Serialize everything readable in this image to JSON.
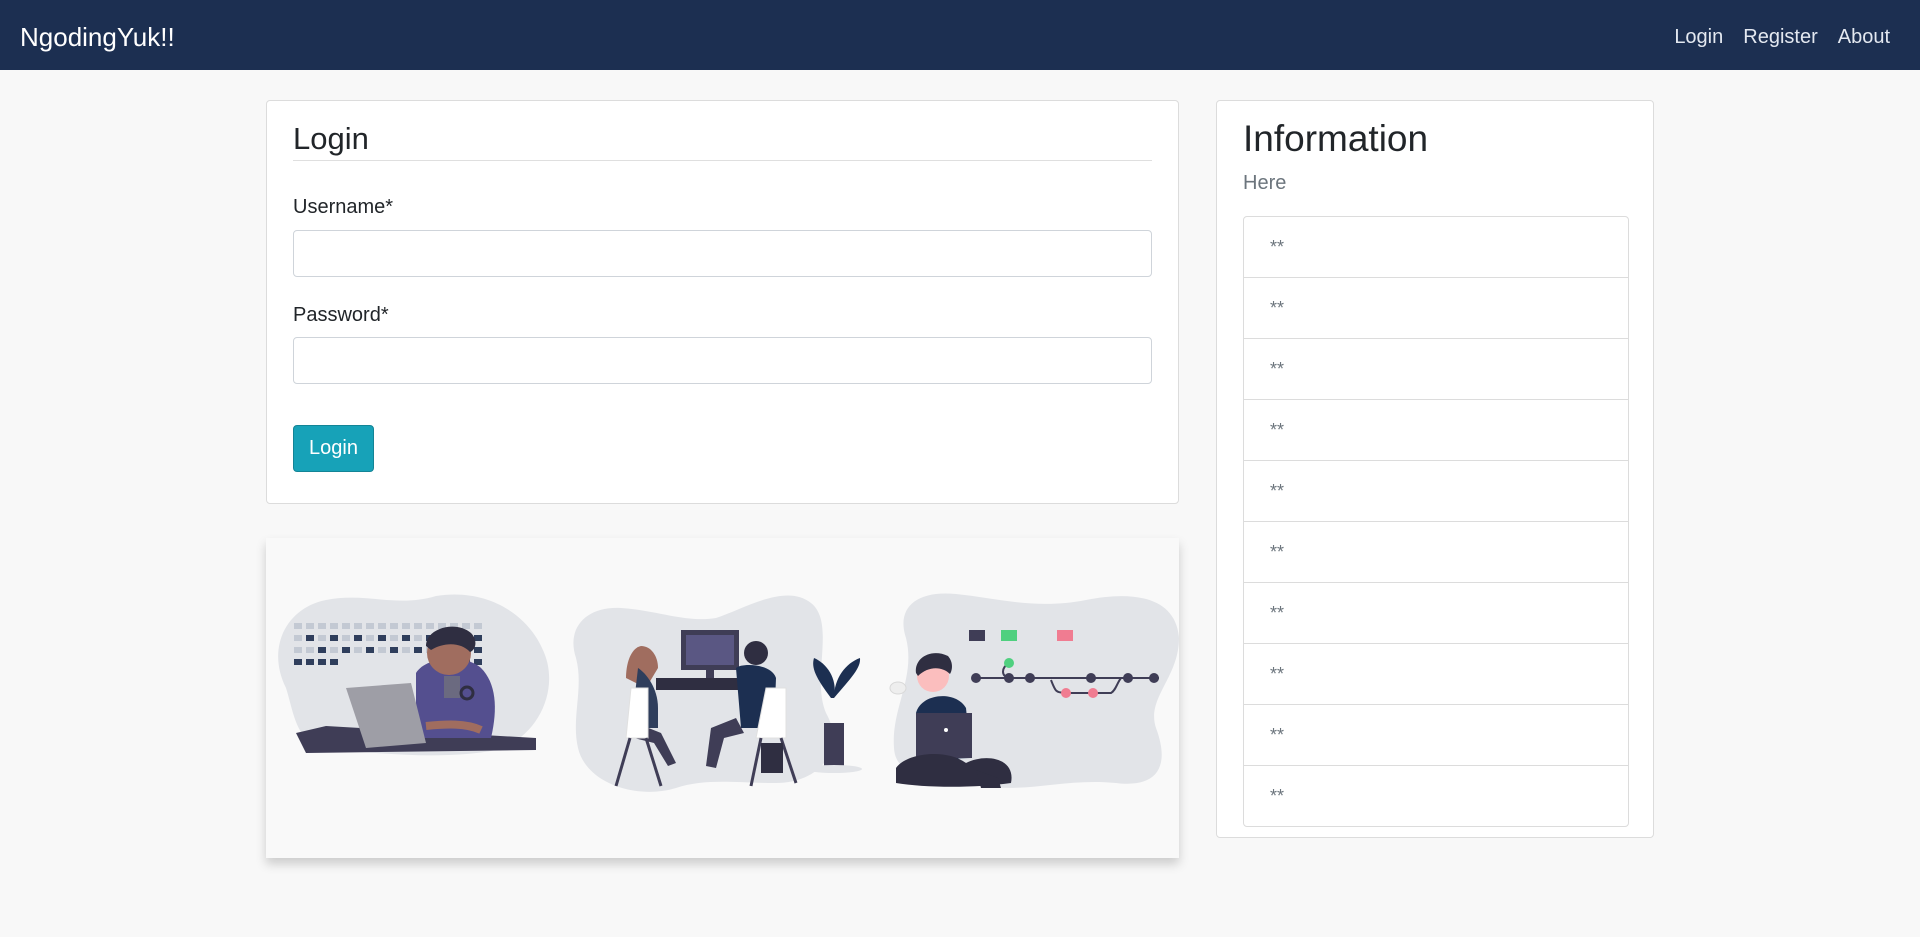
{
  "navbar": {
    "brand": "NgodingYuk!!",
    "links": [
      {
        "label": "Login"
      },
      {
        "label": "Register"
      },
      {
        "label": "About"
      }
    ]
  },
  "login_form": {
    "title": "Login",
    "username": {
      "label": "Username*",
      "value": "",
      "placeholder": ""
    },
    "password": {
      "label": "Password*",
      "value": "",
      "placeholder": ""
    },
    "submit_label": "Login"
  },
  "info_panel": {
    "title": "Information",
    "subtitle": "Here",
    "items": [
      "**",
      "**",
      "**",
      "**",
      "**",
      "**",
      "**",
      "**",
      "**",
      "**"
    ]
  },
  "colors": {
    "navbar_bg": "#1c2f51",
    "button_accent": "#17a2b8",
    "page_bg": "#f8f8f8",
    "illustration_primary": "#3f3d56",
    "illustration_green": "#4fd07f",
    "illustration_pink": "#f07c91"
  },
  "illustration": {
    "scenes": [
      "person-with-laptop-at-desk-icon",
      "two-people-at-computer-icon",
      "person-sitting-with-laptop-icon"
    ]
  }
}
